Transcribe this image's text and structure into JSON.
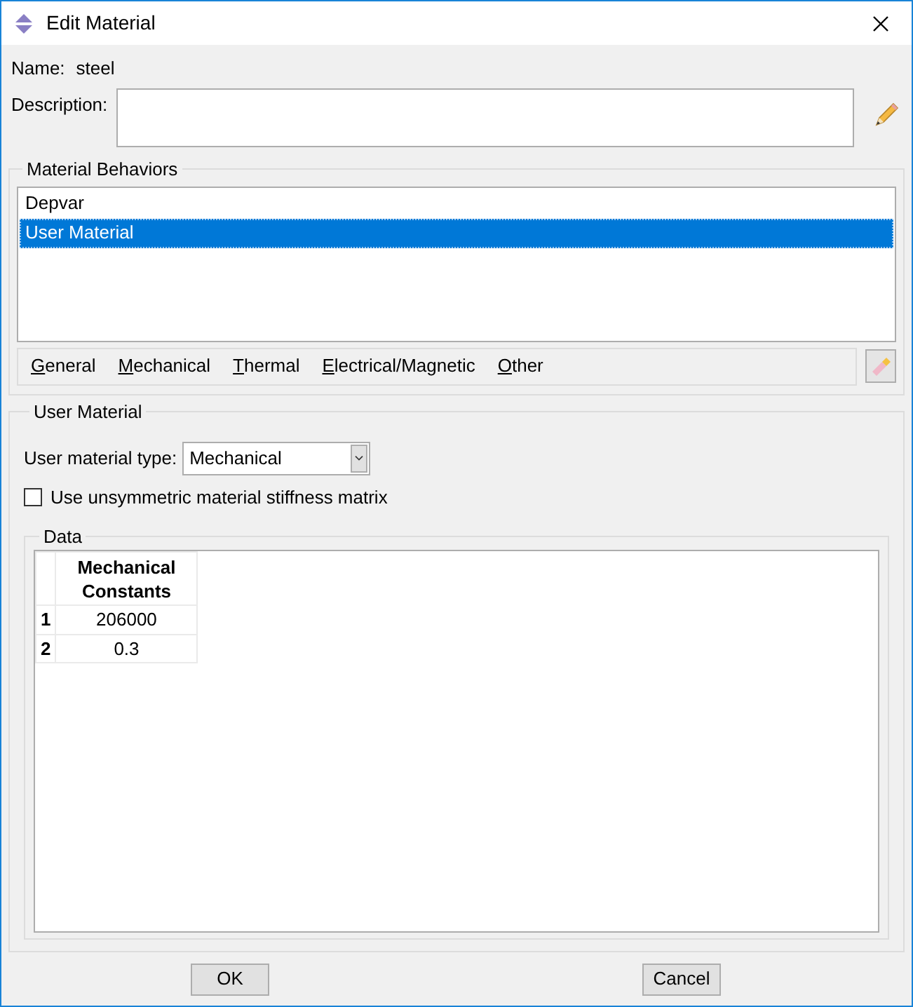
{
  "window": {
    "title": "Edit Material"
  },
  "name": {
    "label": "Name:",
    "value": "steel"
  },
  "description": {
    "label": "Description:"
  },
  "behaviors": {
    "title": "Material Behaviors",
    "items": [
      {
        "label": "Depvar",
        "selected": false
      },
      {
        "label": "User Material",
        "selected": true
      }
    ],
    "menu": [
      "General",
      "Mechanical",
      "Thermal",
      "Electrical/Magnetic",
      "Other"
    ]
  },
  "user_material": {
    "title": "User Material",
    "type_label": "User material type:",
    "type_value": "Mechanical",
    "unsymmetric": {
      "label": "Use unsymmetric material stiffness matrix",
      "checked": false
    },
    "data": {
      "title": "Data",
      "columns": [
        "Mechanical Constants"
      ],
      "rows": [
        {
          "index": "1",
          "cells": [
            "206000"
          ]
        },
        {
          "index": "2",
          "cells": [
            "0.3"
          ]
        }
      ]
    }
  },
  "buttons": [
    "OK",
    "Cancel"
  ]
}
